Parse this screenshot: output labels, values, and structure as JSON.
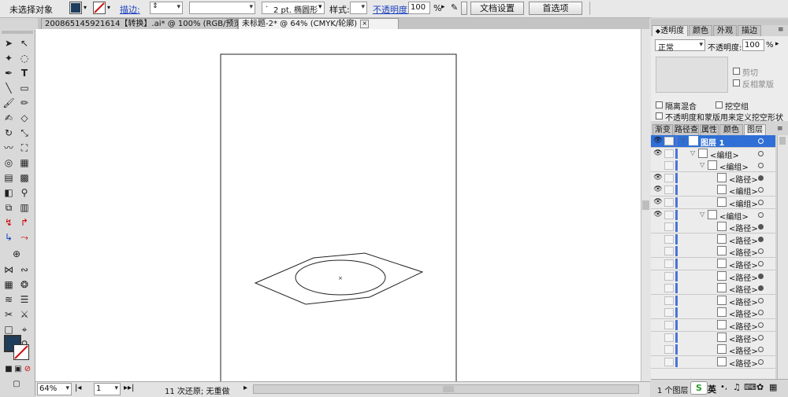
{
  "control_bar": {
    "selection_label": "未选择对象",
    "stroke_label": "描边:",
    "brush_label": "2 pt. 椭圆形",
    "style_label": "样式:",
    "opacity_label": "不透明度:",
    "opacity_value": "100",
    "opacity_unit": "%",
    "doc_setup_button": "文档设置",
    "preferences_button": "首选项",
    "fill_color": "#1f3d5c"
  },
  "tabs": [
    {
      "label": "200865145921614【转换】.ai* @ 100% (RGB/预览)",
      "active": false
    },
    {
      "label": "未标题-2* @ 64% (CMYK/轮廓)",
      "active": true
    }
  ],
  "status": {
    "zoom": "64%",
    "page": "1",
    "history_text": "11 次还原; 无重做"
  },
  "transparency_panel": {
    "tabs": [
      "透明度",
      "颜色",
      "外观",
      "描边"
    ],
    "blend_mode": "正常",
    "opacity_label": "不透明度:",
    "opacity_value": "100",
    "opacity_unit": "%",
    "clip_label": "剪切",
    "invert_mask_label": "反相蒙版",
    "isolate_blending_label": "隔离混合",
    "knockout_group_label": "挖空组",
    "opacity_mask_label": "不透明度和蒙版用来定义挖空形状"
  },
  "layers_panel": {
    "tabs": [
      "渐变",
      "路径查",
      "属性",
      "颜色参",
      "图层"
    ],
    "footer_text": "1 个图层",
    "rows": [
      {
        "name": "图层 1",
        "indent": 0,
        "selected": true,
        "eye": true,
        "expanded": true,
        "filled": false
      },
      {
        "name": "<编组>",
        "indent": 1,
        "selected": false,
        "eye": true,
        "expanded": true,
        "filled": false
      },
      {
        "name": "<编组>",
        "indent": 2,
        "selected": false,
        "eye": false,
        "expanded": true,
        "filled": false
      },
      {
        "name": "<路径>",
        "indent": 3,
        "selected": false,
        "eye": true,
        "expanded": false,
        "filled": true
      },
      {
        "name": "<编组>",
        "indent": 3,
        "selected": false,
        "eye": true,
        "expanded": false,
        "filled": false
      },
      {
        "name": "<编组>",
        "indent": 3,
        "selected": false,
        "eye": true,
        "expanded": false,
        "filled": false
      },
      {
        "name": "<编组>",
        "indent": 2,
        "selected": false,
        "eye": true,
        "expanded": true,
        "filled": false
      },
      {
        "name": "<路径>",
        "indent": 3,
        "selected": false,
        "eye": false,
        "expanded": false,
        "filled": true
      },
      {
        "name": "<路径>",
        "indent": 3,
        "selected": false,
        "eye": false,
        "expanded": false,
        "filled": true
      },
      {
        "name": "<路径>",
        "indent": 3,
        "selected": false,
        "eye": false,
        "expanded": false,
        "filled": false
      },
      {
        "name": "<路径>",
        "indent": 3,
        "selected": false,
        "eye": false,
        "expanded": false,
        "filled": false
      },
      {
        "name": "<路径>",
        "indent": 3,
        "selected": false,
        "eye": false,
        "expanded": false,
        "filled": true
      },
      {
        "name": "<路径>",
        "indent": 3,
        "selected": false,
        "eye": false,
        "expanded": false,
        "filled": true
      },
      {
        "name": "<路径>",
        "indent": 3,
        "selected": false,
        "eye": false,
        "expanded": false,
        "filled": false
      },
      {
        "name": "<路径>",
        "indent": 3,
        "selected": false,
        "eye": false,
        "expanded": false,
        "filled": false
      },
      {
        "name": "<路径>",
        "indent": 3,
        "selected": false,
        "eye": false,
        "expanded": false,
        "filled": false
      },
      {
        "name": "<路径>",
        "indent": 3,
        "selected": false,
        "eye": false,
        "expanded": false,
        "filled": false
      },
      {
        "name": "<路径>",
        "indent": 3,
        "selected": false,
        "eye": false,
        "expanded": false,
        "filled": false
      },
      {
        "name": "<路径>",
        "indent": 3,
        "selected": false,
        "eye": false,
        "expanded": false,
        "filled": false
      }
    ]
  },
  "ime": {
    "language": "英"
  }
}
